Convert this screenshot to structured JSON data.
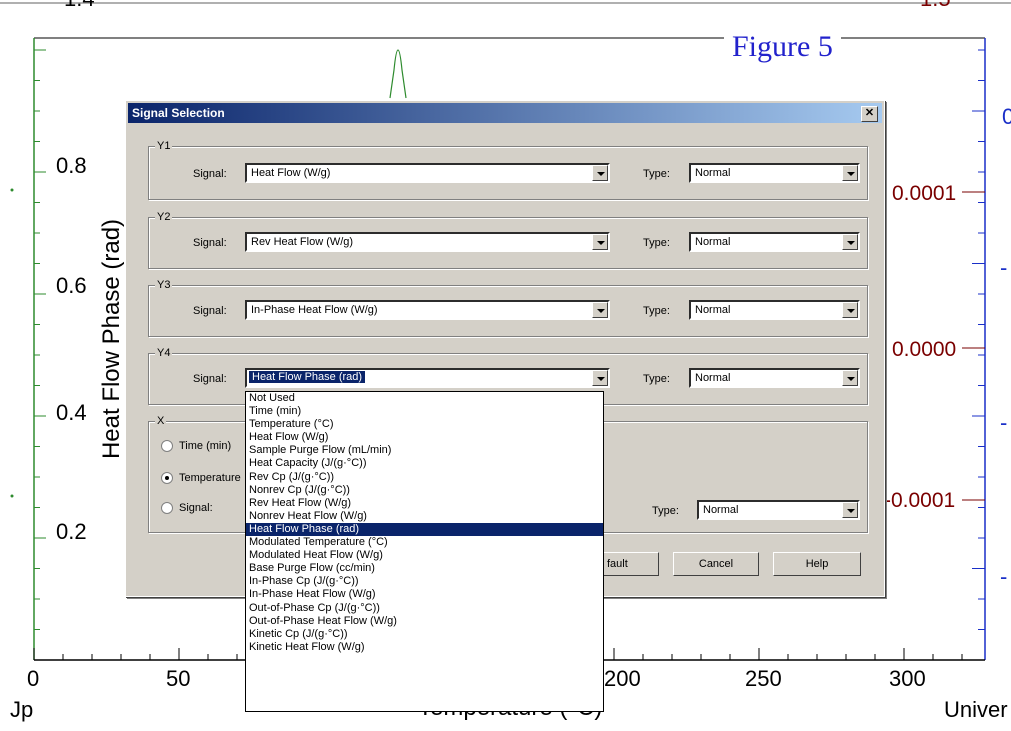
{
  "figure_title": "Figure 5",
  "plot": {
    "y_axis_label": "Heat Flow Phase (rad)",
    "x_axis_label": "Temperature (°C)",
    "left_ticks": [
      "0.8",
      "0.6",
      "0.4",
      "0.2"
    ],
    "right_ticks": [
      "0.0001",
      "0.0000",
      "-0.0001"
    ],
    "x_ticks": [
      "0",
      "50",
      "200",
      "250",
      "300"
    ],
    "corner_left_text": "Jp",
    "corner_right_text": "Univer",
    "top_left_fragment": "1.4",
    "top_right_fragment": "1.5",
    "blue_fragments": [
      "0",
      "-",
      "-",
      "-"
    ],
    "colors": {
      "left_axis": "#2e8b2e",
      "right_axis": "#1a2fc8",
      "right_labels": "#7a0000",
      "title": "#2222cc"
    }
  },
  "dialog": {
    "title": "Signal Selection",
    "close_label": "✕",
    "groups": [
      {
        "legend": "Y1",
        "signal_label": "Signal:",
        "signal_value": "Heat Flow (W/g)",
        "type_label": "Type:",
        "type_value": "Normal"
      },
      {
        "legend": "Y2",
        "signal_label": "Signal:",
        "signal_value": "Rev Heat Flow (W/g)",
        "type_label": "Type:",
        "type_value": "Normal"
      },
      {
        "legend": "Y3",
        "signal_label": "Signal:",
        "signal_value": "In-Phase Heat Flow (W/g)",
        "type_label": "Type:",
        "type_value": "Normal"
      },
      {
        "legend": "Y4",
        "signal_label": "Signal:",
        "signal_value": "Heat Flow Phase (rad)",
        "type_label": "Type:",
        "type_value": "Normal"
      }
    ],
    "x_group": {
      "legend": "X",
      "radio_time": "Time (min)",
      "radio_temperature": "Temperature",
      "radio_signal": "Signal:",
      "type_label": "Type:",
      "type_value": "Normal"
    },
    "buttons": {
      "default_label": "fault",
      "cancel_label": "Cancel",
      "help_label": "Help"
    }
  },
  "dropdown": {
    "items": [
      "Not Used",
      "Time (min)",
      "Temperature (°C)",
      "Heat Flow (W/g)",
      "Sample Purge Flow (mL/min)",
      "Heat Capacity (J/(g·°C))",
      "Rev Cp (J/(g·°C))",
      "Nonrev Cp (J/(g·°C))",
      "Rev Heat Flow (W/g)",
      "Nonrev Heat Flow (W/g)",
      "Heat Flow Phase (rad)",
      "Modulated Temperature (°C)",
      "Modulated Heat Flow (W/g)",
      "Base Purge Flow (cc/min)",
      "In-Phase Cp (J/(g·°C))",
      "In-Phase Heat Flow (W/g)",
      "Out-of-Phase Cp (J/(g·°C))",
      "Out-of-Phase Heat Flow (W/g)",
      "Kinetic Cp (J/(g·°C))",
      "Kinetic Heat Flow (W/g)"
    ],
    "selected": "Heat Flow Phase (rad)"
  }
}
